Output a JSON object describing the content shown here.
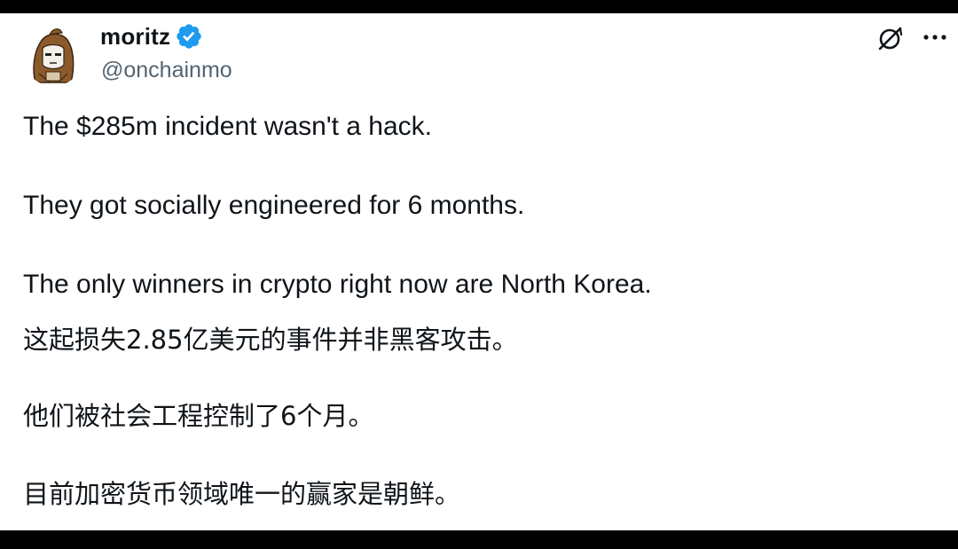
{
  "author": {
    "display_name": "moritz",
    "handle": "@onchainmo",
    "verified": true,
    "avatar": "hooded-cartoon-character"
  },
  "header_icons": {
    "grok": "grok-icon",
    "more": "more-options-icon"
  },
  "tweet": {
    "lines": [
      "The $285m incident wasn't a hack.",
      "They got socially engineered for 6 months.",
      "The only winners in crypto right now are North Korea.",
      "这起损失2.85亿美元的事件并非黑客攻击。",
      "他们被社会工程控制了6个月。",
      "目前加密货币领域唯一的赢家是朝鲜。"
    ]
  },
  "colors": {
    "text": "#0f1419",
    "secondary": "#536471",
    "verified_blue": "#1d9bf0",
    "background": "#ffffff",
    "outer": "#000000"
  }
}
